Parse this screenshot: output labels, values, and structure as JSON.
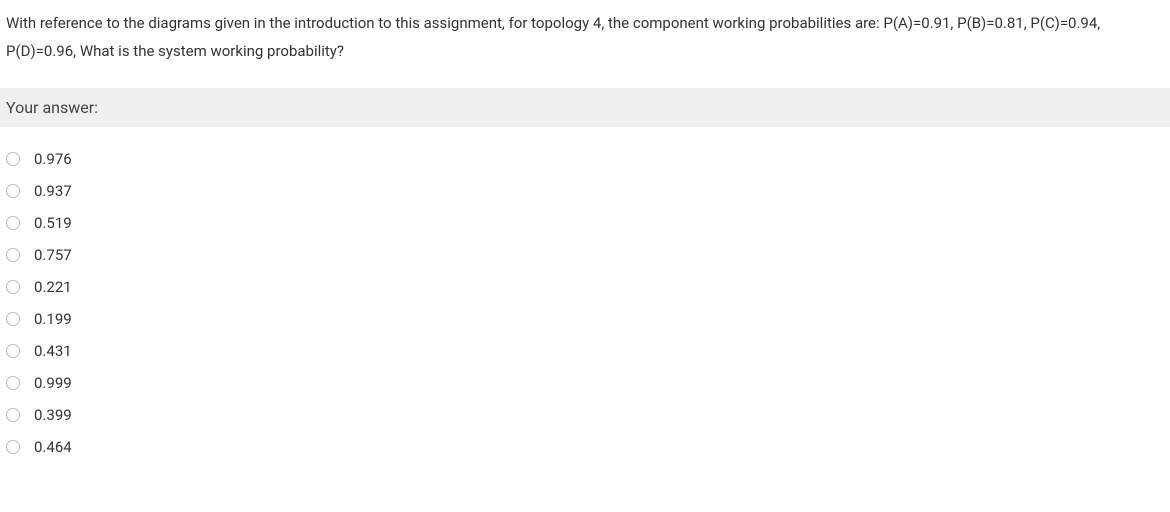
{
  "question": {
    "text": "With reference to the diagrams given in the introduction to this assignment, for topology 4, the component working probabilities are: P(A)=0.91, P(B)=0.81, P(C)=0.94, P(D)=0.96, What is the system working probability?"
  },
  "answer_header": "Your answer:",
  "options": [
    {
      "label": "0.976"
    },
    {
      "label": "0.937"
    },
    {
      "label": "0.519"
    },
    {
      "label": "0.757"
    },
    {
      "label": "0.221"
    },
    {
      "label": "0.199"
    },
    {
      "label": "0.431"
    },
    {
      "label": "0.999"
    },
    {
      "label": "0.399"
    },
    {
      "label": "0.464"
    }
  ]
}
